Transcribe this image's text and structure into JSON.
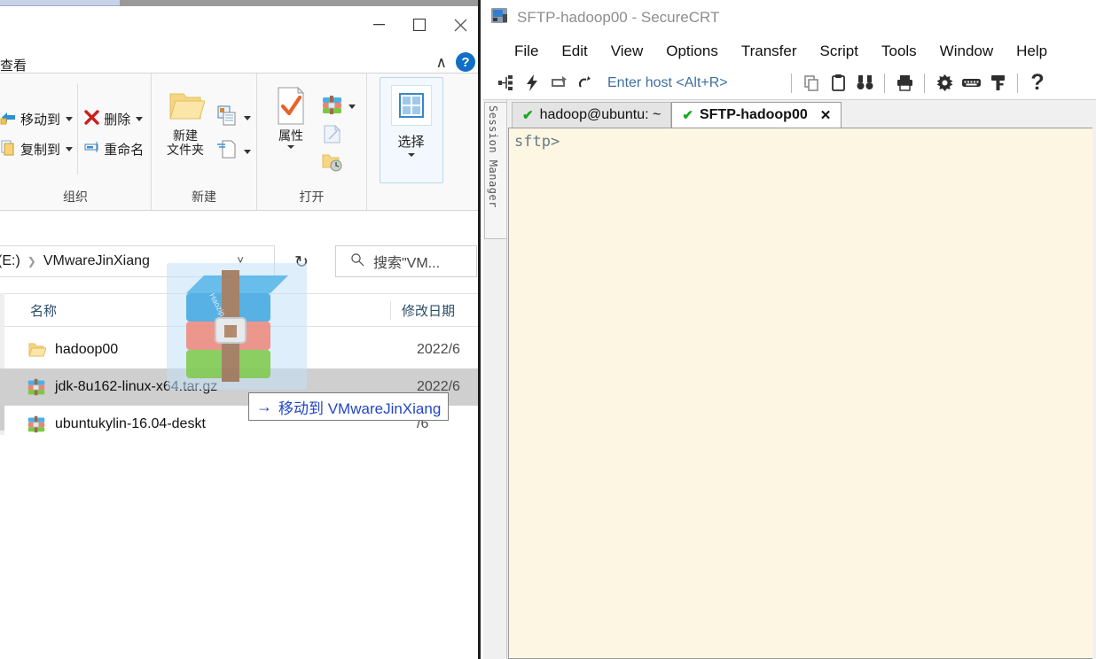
{
  "explorer": {
    "window_controls": {
      "minimize": "—",
      "maximize": "□",
      "close": "✕"
    },
    "ribbon_tab_visible": "查看",
    "help_label": "?",
    "collapse_ribbon": "∧",
    "groups": [
      {
        "label": "组织",
        "items": [
          {
            "label": "移动到",
            "icon": "move-to-icon",
            "has_caret": true
          },
          {
            "label": "复制到",
            "icon": "copy-to-icon",
            "has_caret": true
          },
          {
            "label": "删除",
            "icon": "delete-x-icon",
            "has_caret": true
          },
          {
            "label": "重命名",
            "icon": "rename-icon",
            "has_caret": false
          }
        ]
      },
      {
        "label": "新建",
        "items": [
          {
            "label": "新建\n文件夹",
            "label_line1": "新建",
            "label_line2": "文件夹",
            "icon": "new-folder-icon"
          },
          {
            "label": "",
            "icon": "new-item-icon",
            "has_caret": true
          },
          {
            "label": "",
            "icon": "easy-access-icon",
            "has_caret": true
          }
        ]
      },
      {
        "label": "打开",
        "items": [
          {
            "label": "属性",
            "icon": "properties-icon",
            "has_caret": true
          },
          {
            "label": "",
            "icon": "archive-open-with-icon",
            "has_caret": true
          },
          {
            "label": "",
            "icon": "edit-icon",
            "has_caret": false
          },
          {
            "label": "",
            "icon": "history-icon",
            "has_caret": false
          }
        ]
      },
      {
        "label": "",
        "items": [
          {
            "label": "选择",
            "icon": "select-grid-icon",
            "has_caret": true
          }
        ]
      }
    ],
    "address": {
      "drive": "(E:)",
      "separator": "❯",
      "folder": "VMwareJinXiang",
      "dropdown_icon": "chevron-down-icon",
      "refresh_icon": "refresh-icon"
    },
    "search": {
      "placeholder": "搜索\"VM...",
      "icon": "search-icon"
    },
    "columns": {
      "name": "名称",
      "date": "修改日期"
    },
    "files": [
      {
        "name": "hadoop00",
        "date": "2022/6",
        "icon": "folder-icon",
        "selected": false
      },
      {
        "name": "jdk-8u162-linux-x64.tar.gz",
        "date": "2022/6",
        "icon": "archive-icon",
        "selected": true
      },
      {
        "name": "ubuntukylin-16.04-deskt",
        "date": "/6",
        "icon": "archive-icon",
        "selected": false
      }
    ],
    "drag": {
      "tooltip_arrow": "→",
      "tooltip_text": "移动到 VMwareJinXiang",
      "ghost_icon": "archive-drag-ghost-icon",
      "ghost_watermark": "Haozip"
    }
  },
  "securecrt": {
    "title": "SFTP-hadoop00 - SecureCRT",
    "app_icon": "securecrt-app-icon",
    "menus": [
      "File",
      "Edit",
      "View",
      "Options",
      "Transfer",
      "Script",
      "Tools",
      "Window",
      "Help"
    ],
    "toolbar": {
      "host_placeholder": "Enter host <Alt+R>",
      "icons": [
        "connect-icon",
        "quick-connect-icon",
        "connect-in-tab-icon",
        "reconnect-icon",
        "copy-icon",
        "paste-icon",
        "find-icon",
        "print-icon",
        "settings-gear-icon",
        "keyboard-icon",
        "key-icon",
        "help-question-icon"
      ]
    },
    "session_manager_label": "Session Manager",
    "tabs": [
      {
        "label": "hadoop@ubuntu: ~",
        "status_icon": "green-check-icon",
        "active": false,
        "closable": false
      },
      {
        "label": "SFTP-hadoop00",
        "status_icon": "green-check-icon",
        "active": true,
        "closable": true,
        "close_label": "✕"
      }
    ],
    "terminal": {
      "prompt": "sftp>",
      "background": "#fdf6e3",
      "text_color": "#657b83"
    }
  }
}
